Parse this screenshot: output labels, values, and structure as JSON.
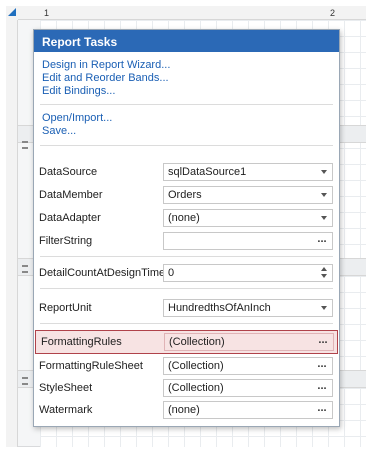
{
  "ruler": {
    "marks": [
      "1",
      "2"
    ]
  },
  "popup": {
    "title": "Report Tasks",
    "links_group1": [
      "Design in Report Wizard...",
      "Edit and Reorder Bands...",
      "Edit Bindings..."
    ],
    "links_group2": [
      "Open/Import...",
      "Save..."
    ],
    "properties": [
      {
        "label": "DataSource",
        "value": "sqlDataSource1",
        "editor": "dropdown"
      },
      {
        "label": "DataMember",
        "value": "Orders",
        "editor": "dropdown"
      },
      {
        "label": "DataAdapter",
        "value": "(none)",
        "editor": "dropdown"
      },
      {
        "label": "FilterString",
        "value": "",
        "editor": "ellipsis"
      },
      {
        "label": "DetailCountAtDesignTime",
        "value": "0",
        "editor": "spin"
      },
      {
        "label": "ReportUnit",
        "value": "HundredthsOfAnInch",
        "editor": "dropdown"
      },
      {
        "label": "FormattingRules",
        "value": "(Collection)",
        "editor": "ellipsis",
        "highlighted": true
      },
      {
        "label": "FormattingRuleSheet",
        "value": "(Collection)",
        "editor": "ellipsis"
      },
      {
        "label": "StyleSheet",
        "value": "(Collection)",
        "editor": "ellipsis"
      },
      {
        "label": "Watermark",
        "value": "(none)",
        "editor": "ellipsis"
      }
    ],
    "ellipsis_glyph": "..."
  },
  "colors": {
    "header": "#2b69b6",
    "link": "#1a5fb4",
    "highlight_border": "#b0424a",
    "highlight_fill": "#f7e3e3"
  }
}
